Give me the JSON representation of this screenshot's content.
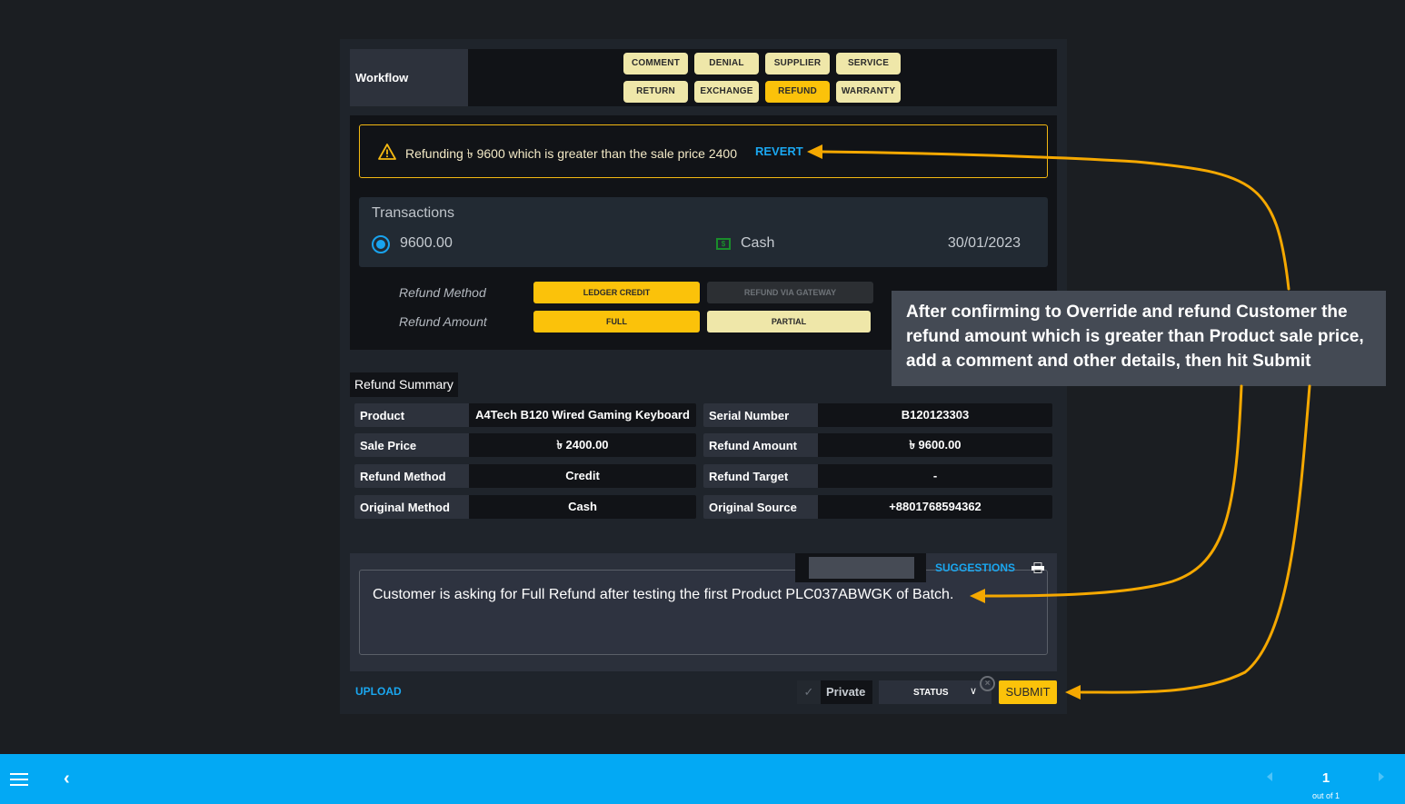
{
  "workflow": {
    "label": "Workflow",
    "buttons": [
      {
        "label": "COMMENT",
        "active": false
      },
      {
        "label": "DENIAL",
        "active": false
      },
      {
        "label": "SUPPLIER",
        "active": false
      },
      {
        "label": "SERVICE",
        "active": false
      },
      {
        "label": "RETURN",
        "active": false
      },
      {
        "label": "EXCHANGE",
        "active": false
      },
      {
        "label": "REFUND",
        "active": true
      },
      {
        "label": "WARRANTY",
        "active": false
      }
    ]
  },
  "alert": {
    "icon": "warning-icon",
    "message": "Refunding ৳ 9600 which is greater than the sale price 2400",
    "action": "REVERT"
  },
  "transactions": {
    "title": "Transactions",
    "items": [
      {
        "amount": "9600.00",
        "method_icon": "cash-icon",
        "method": "Cash",
        "date": "30/01/2023",
        "selected": true
      }
    ]
  },
  "refund_options": {
    "method_label": "Refund Method",
    "amount_label": "Refund Amount",
    "method_options": [
      {
        "label": "LEDGER CREDIT",
        "state": "selected"
      },
      {
        "label": "REFUND VIA GATEWAY",
        "state": "disabled"
      }
    ],
    "amount_options": [
      {
        "label": "FULL",
        "state": "selected"
      },
      {
        "label": "PARTIAL",
        "state": "unselected"
      }
    ]
  },
  "summary": {
    "title": "Refund Summary",
    "left": [
      {
        "key": "Product",
        "value": "A4Tech B120 Wired Gaming Keyboard"
      },
      {
        "key": "Sale Price",
        "value": "৳ 2400.00"
      },
      {
        "key": "Refund Method",
        "value": "Credit"
      },
      {
        "key": "Original Method",
        "value": "Cash"
      }
    ],
    "right": [
      {
        "key": "Serial Number",
        "value": "B120123303"
      },
      {
        "key": "Refund Amount",
        "value": "৳ 9600.00"
      },
      {
        "key": "Refund Target",
        "value": "-"
      },
      {
        "key": "Original Source",
        "value": "+8801768594362"
      }
    ]
  },
  "comment": {
    "text": "Customer is asking for Full Refund after testing the first Product PLC037ABWGK of Batch.",
    "suggestions_label": "SUGGESTIONS",
    "suggestion_input_value": ""
  },
  "footer": {
    "upload_label": "UPLOAD",
    "private_label": "Private",
    "private_checked": false,
    "status_label": "STATUS",
    "submit_label": "SUBMIT"
  },
  "callout": {
    "text": "After confirming to Override and refund Customer the refund amount which is greater than Product sale price, add a comment and other details, then hit Submit"
  },
  "pagination": {
    "current": "1",
    "total_text": "out of 1"
  },
  "colors": {
    "accent_yellow": "#fbc20a",
    "button_light": "#efe7a9",
    "link_blue": "#1aa7f0",
    "bar_blue": "#03a9f4",
    "annotation_orange": "#f5a800"
  }
}
